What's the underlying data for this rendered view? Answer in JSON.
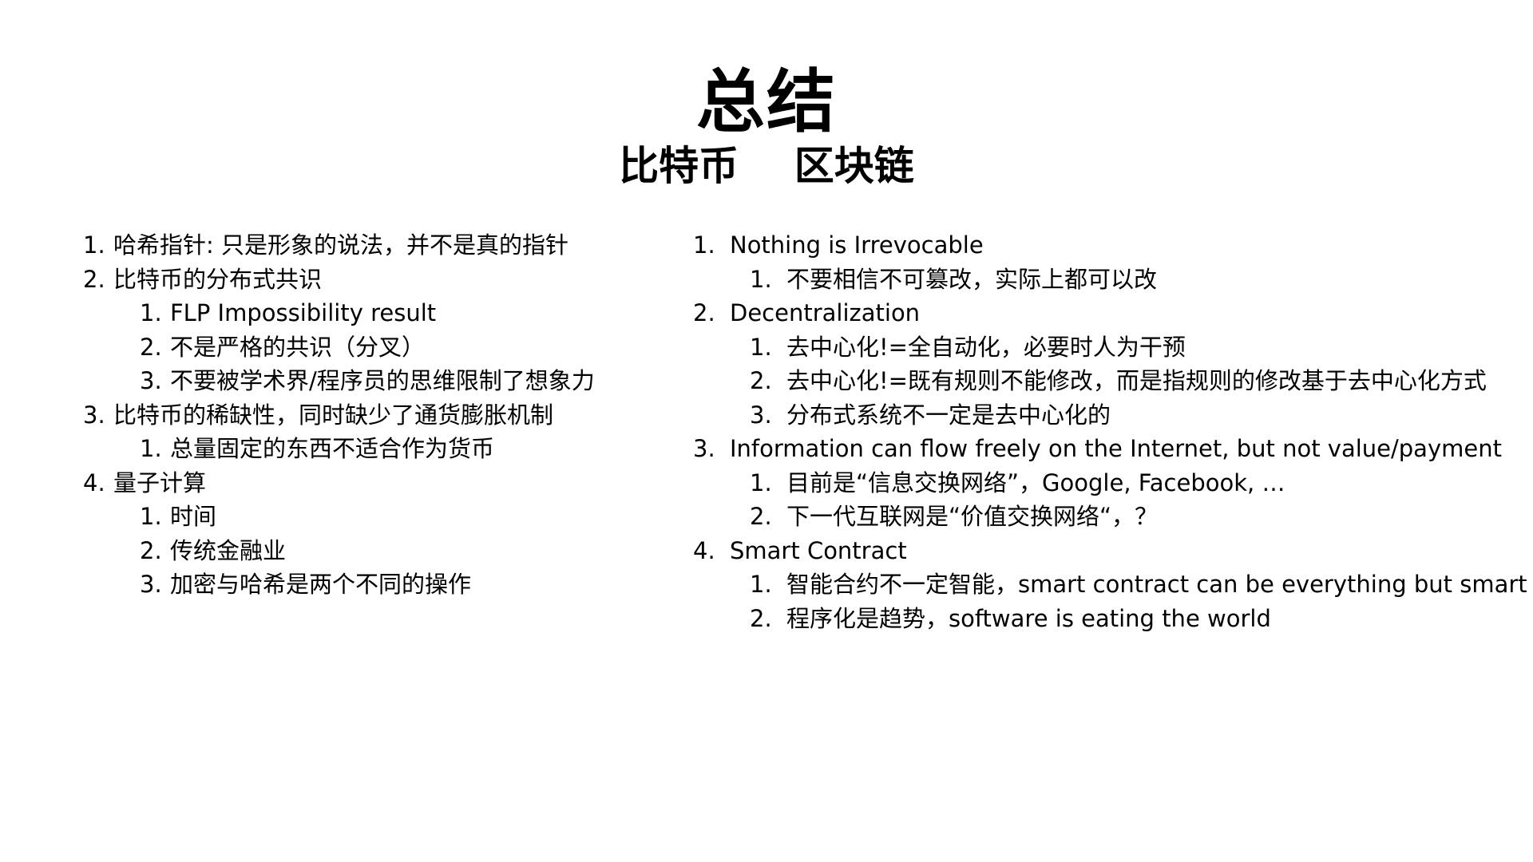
{
  "title": "总结",
  "subtitle": "比特币    区块链",
  "left": [
    {
      "num": "1.",
      "text": "哈希指针: 只是形象的说法，并不是真的指针",
      "children": []
    },
    {
      "num": "2.",
      "text": "比特币的分布式共识",
      "children": [
        {
          "num": "1.",
          "text": "FLP Impossibility result"
        },
        {
          "num": "2.",
          "text": "不是严格的共识（分叉）"
        },
        {
          "num": "3.",
          "text": "不要被学术界/程序员的思维限制了想象力"
        }
      ]
    },
    {
      "num": "3.",
      "text": "比特币的稀缺性，同时缺少了通货膨胀机制",
      "children": [
        {
          "num": "1.",
          "text": "总量固定的东西不适合作为货币"
        }
      ]
    },
    {
      "num": "4.",
      "text": "量子计算",
      "children": [
        {
          "num": "1.",
          "text": "时间"
        },
        {
          "num": "2.",
          "text": "传统金融业"
        },
        {
          "num": "3.",
          "text": "加密与哈希是两个不同的操作"
        }
      ]
    }
  ],
  "right": [
    {
      "num": "1.",
      "text": "Nothing is Irrevocable",
      "children": [
        {
          "num": "1.",
          "text": "不要相信不可篡改，实际上都可以改"
        }
      ]
    },
    {
      "num": "2.",
      "text": "Decentralization",
      "children": [
        {
          "num": "1.",
          "text": "去中心化!=全自动化，必要时人为干预"
        },
        {
          "num": "2.",
          "text": "去中心化!=既有规则不能修改，而是指规则的修改基于去中心化方式"
        },
        {
          "num": "3.",
          "text": "分布式系统不一定是去中心化的"
        }
      ]
    },
    {
      "num": "3.",
      "text": "Information can flow freely on the Internet, but not value/payment",
      "children": [
        {
          "num": "1.",
          "text": "目前是“信息交换网络”，Google, Facebook, …"
        },
        {
          "num": "2.",
          "text": "下一代互联网是“价值交换网络“，？"
        }
      ]
    },
    {
      "num": "4.",
      "text": "Smart Contract",
      "children": [
        {
          "num": "1.",
          "text": "智能合约不一定智能，smart contract can be everything but smart"
        },
        {
          "num": "2.",
          "text": "程序化是趋势，software is eating the world"
        }
      ]
    }
  ]
}
